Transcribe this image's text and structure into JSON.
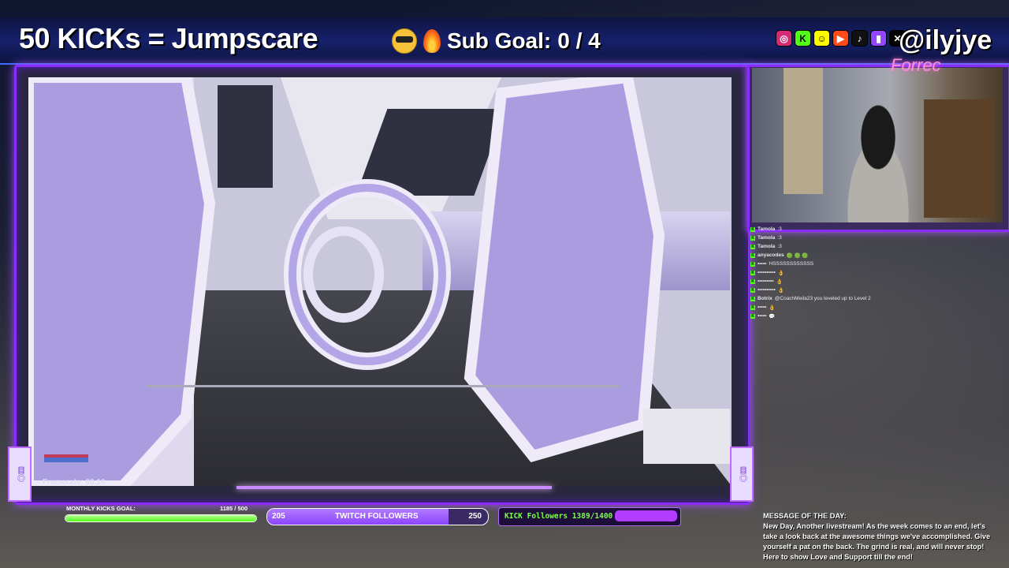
{
  "overlay": {
    "title": "50 KICKs = Jumpscare",
    "sub_goal": {
      "label": "Sub Goal:",
      "value": "0 / 4"
    },
    "handle": "@ilyjye",
    "social_icons": [
      "instagram-icon",
      "kick-icon",
      "snapchat-icon",
      "youtube-icon",
      "tiktok-icon",
      "twitch-icon",
      "x-icon"
    ],
    "accent_color": "#8a2bff"
  },
  "game": {
    "framerate_label": "Framerate:",
    "framerate_value": "60.16",
    "scene": "space-station-corridor"
  },
  "webcam": {
    "label": "Forrec"
  },
  "chat": {
    "messages": [
      {
        "user": "Tamola",
        "text": ":3"
      },
      {
        "user": "Tamola",
        "text": ":3"
      },
      {
        "user": "Tamola",
        "text": ":3"
      },
      {
        "user": "anyacodes",
        "text": "🟢 🟢 🟢"
      },
      {
        "user": "•••••",
        "text": "HSSSSSSSSSSSS"
      },
      {
        "user": "••••••••••",
        "text": "👌"
      },
      {
        "user": "•••••••••",
        "text": "👌"
      },
      {
        "user": "••••••••••",
        "text": "👌"
      },
      {
        "user": "Botrix",
        "text": "@CoachMeila23 you leveled up to Level 2"
      },
      {
        "user": "•••••",
        "text": "👌"
      },
      {
        "user": "•••••",
        "text": "💬"
      }
    ]
  },
  "bottom": {
    "kicks_goal": {
      "label": "MONTHLY KICKS GOAL:",
      "value": "1185 / 500",
      "progress": 1.0
    },
    "twitch_followers": {
      "start": "205",
      "label": "TWITCH FOLLOWERS",
      "end": "250",
      "progress": 0.82
    },
    "kick_followers": {
      "label": "KICK Followers 1389/1400",
      "progress": 0.99
    }
  },
  "motd": {
    "heading": "MESSAGE OF THE DAY:",
    "body": "New Day, Another livestream! As the week comes to an end, let's take a look back at the awesome things we've accomplished. Give yourself a pat on the back. The grind is real, and will never stop! Here to show Love and Support till the end!"
  }
}
